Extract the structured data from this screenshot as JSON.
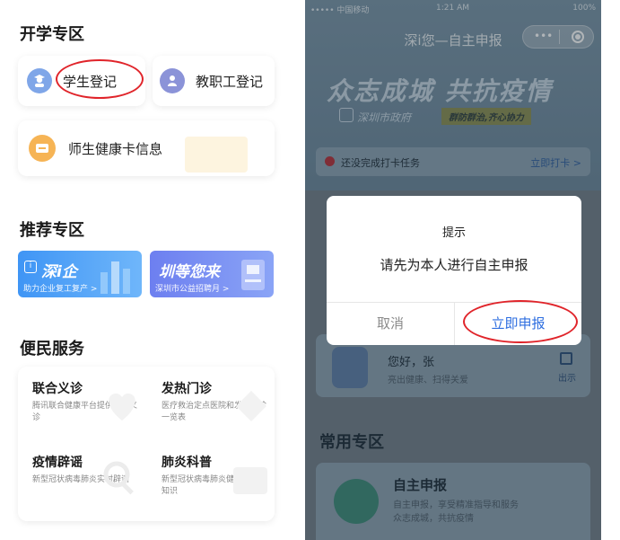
{
  "left": {
    "school": {
      "title": "开学专区",
      "student_label": "学生登记",
      "staff_label": "教职工登记",
      "health_label": "师生健康卡信息"
    },
    "recommend": {
      "title": "推荐专区",
      "banner1_title": "深i企",
      "banner1_sub": "助力企业复工复产 >",
      "banner2_title": "圳等您来",
      "banner2_sub": "深圳市公益招聘月 >"
    },
    "services": {
      "title": "便民服务",
      "items": [
        {
          "title": "联合义诊",
          "desc": "腾讯联合健康平台提供在线义诊"
        },
        {
          "title": "发热门诊",
          "desc": "医疗救治定点医院和发热门诊一览表"
        },
        {
          "title": "疫情辟谣",
          "desc": "新型冠状病毒肺炎实时辟谣"
        },
        {
          "title": "肺炎科普",
          "desc": "新型冠状病毒肺炎健康科普小知识"
        }
      ]
    }
  },
  "right": {
    "status": {
      "carrier": "••••• 中国移动",
      "time": "1:21 AM",
      "battery": "100%"
    },
    "nav_title": "深i您—自主申报",
    "capsule_dots": "•••",
    "hero": {
      "slogan": "众志成城 共抗疫情",
      "gov": "深圳市政府",
      "tag": "群防群治,齐心协力"
    },
    "task": {
      "text": "还没完成打卡任务",
      "action": "立即打卡 >"
    },
    "greet": {
      "name": "您好，张",
      "sub": "亮出健康、扫得关爱",
      "show": "出示"
    },
    "common_title": "常用专区",
    "app": {
      "title": "自主申报",
      "line1": "自主申报，享受精准指导和服务",
      "line2": "众志成城，共抗疫情"
    },
    "dialog": {
      "title": "提示",
      "message": "请先为本人进行自主申报",
      "cancel": "取消",
      "confirm": "立即申报"
    }
  },
  "colors": {
    "annotation_red": "#e0242a",
    "primary_blue": "#2f6fe0"
  }
}
